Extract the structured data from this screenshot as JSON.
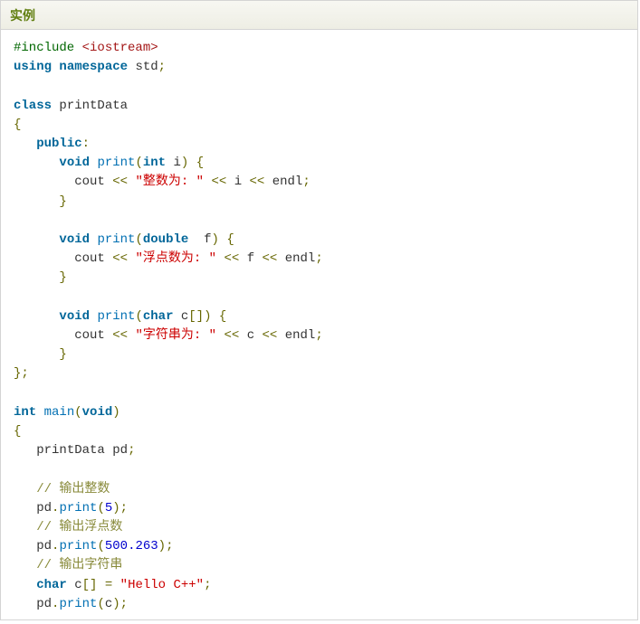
{
  "header": {
    "title": "实例"
  },
  "code": {
    "line1_directive": "#include",
    "line1_target": "<iostream>",
    "line2_kw_using": "using",
    "line2_kw_namespace": "namespace",
    "line2_ns": "std",
    "line4_kw_class": "class",
    "line4_classname": "printData",
    "line6_kw_public": "public",
    "line7_kw_void": "void",
    "line7_func": "print",
    "line7_kw_int": "int",
    "line7_param": "i",
    "line8_cout": "cout",
    "line8_str": "\"整数为: \"",
    "line8_var": "i",
    "line8_endl": "endl",
    "line11_kw_void": "void",
    "line11_func": "print",
    "line11_kw_double": "double",
    "line11_param": "f",
    "line12_cout": "cout",
    "line12_str": "\"浮点数为: \"",
    "line12_var": "f",
    "line12_endl": "endl",
    "line15_kw_void": "void",
    "line15_func": "print",
    "line15_kw_char": "char",
    "line15_param": "c",
    "line16_cout": "cout",
    "line16_str": "\"字符串为: \"",
    "line16_var": "c",
    "line16_endl": "endl",
    "line20_kw_int": "int",
    "line20_func": "main",
    "line20_kw_void": "void",
    "line22_type": "printData",
    "line22_var": "pd",
    "line24_comment": "// 输出整数",
    "line25_obj": "pd",
    "line25_method": "print",
    "line25_arg": "5",
    "line26_comment": "// 输出浮点数",
    "line27_obj": "pd",
    "line27_method": "print",
    "line27_arg": "500.263",
    "line28_comment": "// 输出字符串",
    "line29_kw_char": "char",
    "line29_var": "c",
    "line29_str": "\"Hello C++\"",
    "line30_obj": "pd",
    "line30_method": "print",
    "line30_arg": "c"
  }
}
